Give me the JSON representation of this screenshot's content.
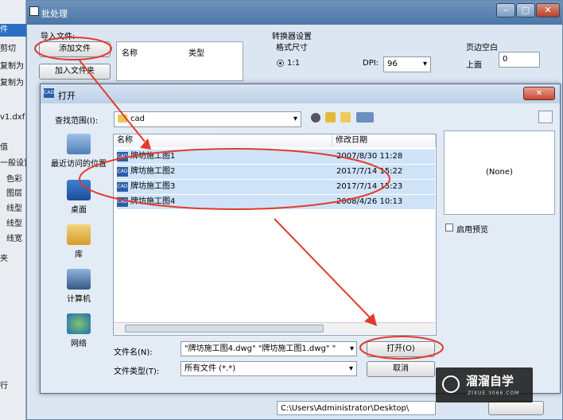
{
  "host_left": {
    "items": [
      "件",
      "剪切",
      "复制为",
      "复制为",
      "v1.dxf",
      "值",
      "一般设置",
      "色彩",
      "图层",
      "线型",
      "线型",
      "线宽",
      "夹",
      "行"
    ]
  },
  "batch": {
    "title": "批处理",
    "import_label": "导入文件:",
    "add_file": "添加文件",
    "add_folder": "加入文件夹",
    "col_name": "名称",
    "col_type": "类型",
    "converter_label": "转换器设置",
    "format_size": "格式尺寸",
    "ratio": "1:1",
    "dpi_label": "DPI:",
    "dpi_value": "96",
    "margin_label": "页边空白",
    "top_label": "上面",
    "top_value": "0",
    "output_path": "C:\\Users\\Administrator\\Desktop\\"
  },
  "dialog": {
    "title": "打开",
    "look_in_label": "查找范围(I):",
    "look_in_value": "cad",
    "places": [
      "最近访问的位置",
      "桌面",
      "库",
      "计算机",
      "网络"
    ],
    "col_name": "名称",
    "col_date": "修改日期",
    "files": [
      {
        "name": "牌坊施工图1",
        "date": "2007/8/30 11:28"
      },
      {
        "name": "牌坊施工图2",
        "date": "2017/7/14 15:22"
      },
      {
        "name": "牌坊施工图3",
        "date": "2017/7/14 15:23"
      },
      {
        "name": "牌坊施工图4",
        "date": "2008/4/26 10:13"
      }
    ],
    "preview_text": "(None)",
    "enable_preview": "启用预览",
    "filename_label": "文件名(N):",
    "filename_value": "\"牌坊施工图4.dwg\" \"牌坊施工图1.dwg\" \"",
    "filetype_label": "文件类型(T):",
    "filetype_value": "所有文件 (*.*)",
    "open_button": "打开(O)",
    "cancel_button": "取消"
  },
  "watermark": {
    "name": "溜溜自学",
    "url": "ZIXUE.3066.COM"
  },
  "colors": {
    "annotation": "#e23a2c",
    "selection": "#cfe3f8"
  }
}
